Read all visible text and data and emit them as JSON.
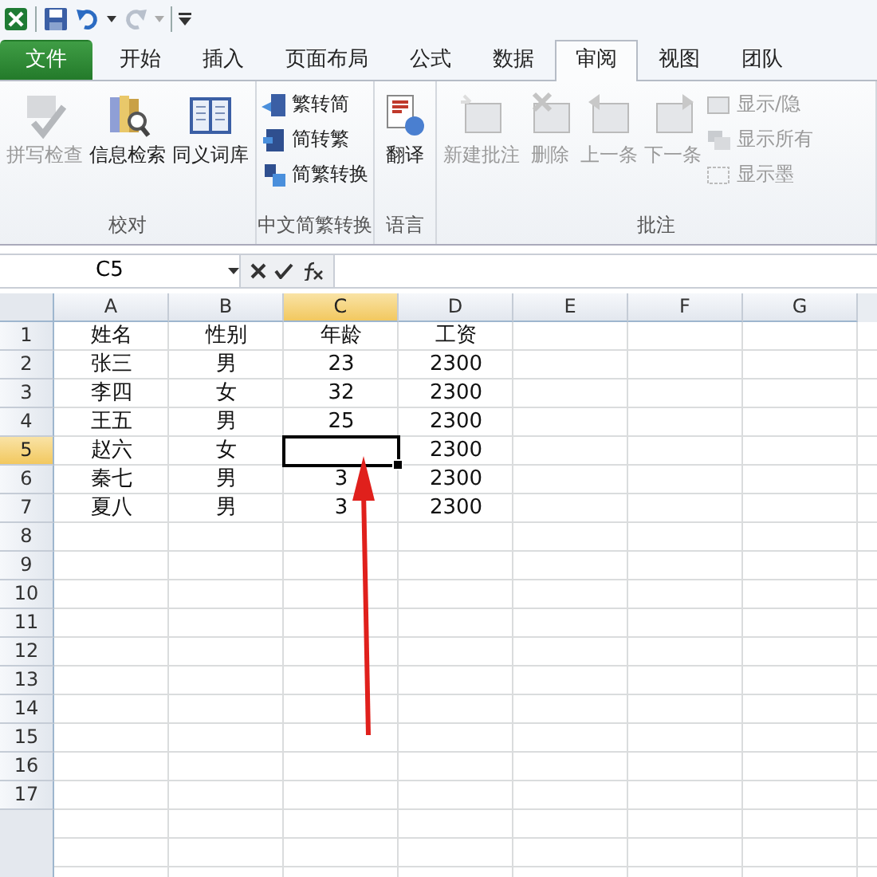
{
  "tabs": [
    {
      "label": "文件",
      "kind": "file",
      "selected": false
    },
    {
      "label": "开始",
      "kind": "tab",
      "selected": false
    },
    {
      "label": "插入",
      "kind": "tab",
      "selected": false
    },
    {
      "label": "页面布局",
      "kind": "tab",
      "selected": false
    },
    {
      "label": "公式",
      "kind": "tab",
      "selected": false
    },
    {
      "label": "数据",
      "kind": "tab",
      "selected": false
    },
    {
      "label": "审阅",
      "kind": "tab",
      "selected": true
    },
    {
      "label": "视图",
      "kind": "tab",
      "selected": false
    },
    {
      "label": "团队",
      "kind": "tab",
      "selected": false
    }
  ],
  "ribbon_groups": [
    {
      "label": "校对",
      "buttons": [
        {
          "label": "拼写检查",
          "kind": "large",
          "disabled": true
        },
        {
          "label": "信息检索",
          "kind": "large",
          "disabled": false
        },
        {
          "label": "同义词库",
          "kind": "large",
          "disabled": false
        }
      ]
    },
    {
      "label": "中文简繁转换",
      "buttons": [
        {
          "label": "繁转简",
          "kind": "small",
          "disabled": false
        },
        {
          "label": "简转繁",
          "kind": "small",
          "disabled": false
        },
        {
          "label": "简繁转换",
          "kind": "small",
          "disabled": false
        }
      ]
    },
    {
      "label": "语言",
      "buttons": [
        {
          "label": "翻译",
          "kind": "large",
          "disabled": false
        }
      ]
    },
    {
      "label": "批注",
      "buttons": [
        {
          "label": "新建批注",
          "kind": "large",
          "disabled": true
        },
        {
          "label": "删除",
          "kind": "large",
          "disabled": true
        },
        {
          "label": "上一条",
          "kind": "large",
          "disabled": true
        },
        {
          "label": "下一条",
          "kind": "large",
          "disabled": true
        },
        {
          "label": "显示/隐",
          "kind": "small",
          "disabled": true
        },
        {
          "label": "显示所有",
          "kind": "small",
          "disabled": true
        },
        {
          "label": "显示墨",
          "kind": "small",
          "disabled": true
        }
      ]
    }
  ],
  "name_box": {
    "value": "C5"
  },
  "sheet": {
    "columns": [
      {
        "label": "A",
        "selected": false
      },
      {
        "label": "B",
        "selected": false
      },
      {
        "label": "C",
        "selected": true
      },
      {
        "label": "D",
        "selected": false
      },
      {
        "label": "E",
        "selected": false
      },
      {
        "label": "F",
        "selected": false
      },
      {
        "label": "G",
        "selected": false
      }
    ],
    "rows": [
      {
        "number": "1",
        "selected": false,
        "cells": [
          "姓名",
          "性别",
          "年龄",
          "工资"
        ]
      },
      {
        "number": "2",
        "selected": false,
        "cells": [
          "张三",
          "男",
          "23",
          "2300"
        ]
      },
      {
        "number": "3",
        "selected": false,
        "cells": [
          "李四",
          "女",
          "32",
          "2300"
        ]
      },
      {
        "number": "4",
        "selected": false,
        "cells": [
          "王五",
          "男",
          "25",
          "2300"
        ]
      },
      {
        "number": "5",
        "selected": true,
        "cells": [
          "赵六",
          "女",
          null,
          "2300"
        ]
      },
      {
        "number": "6",
        "selected": false,
        "cells": [
          "秦七",
          "男",
          "3",
          "2300"
        ]
      },
      {
        "number": "7",
        "selected": false,
        "cells": [
          "夏八",
          "男",
          "3",
          "2300"
        ]
      },
      {
        "number": "8",
        "selected": false
      },
      {
        "number": "9",
        "selected": false
      },
      {
        "number": "10",
        "selected": false
      },
      {
        "number": "11",
        "selected": false
      },
      {
        "number": "12",
        "selected": false
      },
      {
        "number": "13",
        "selected": false
      },
      {
        "number": "14",
        "selected": false
      },
      {
        "number": "15",
        "selected": false
      },
      {
        "number": "16",
        "selected": false
      },
      {
        "number": "17",
        "selected": false
      }
    ]
  }
}
